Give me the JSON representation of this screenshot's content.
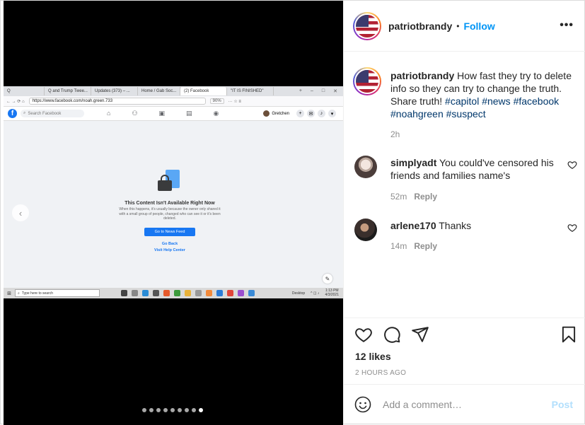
{
  "media": {
    "screenshot": {
      "tabs": [
        {
          "label": "Q",
          "active": false
        },
        {
          "label": "Q and Trump Twee...",
          "active": false
        },
        {
          "label": "Updates (373) – ...",
          "active": false
        },
        {
          "label": "Home / Gab Soc...",
          "active": false
        },
        {
          "label": "(2) Facebook",
          "active": true
        },
        {
          "label": "\"IT IS FINISHED\"",
          "active": false
        }
      ],
      "url": "https://www.facebook.com/noah.green.733",
      "zoom": "90%",
      "fb_search_placeholder": "Search Facebook",
      "fb_user": "Gretchen",
      "notif_count": "1",
      "title": "This Content Isn't Available Right Now",
      "body": "When this happens, it's usually because the owner only shared it with a small group of people, changed who can see it or it's been deleted.",
      "news_feed_button": "Go to News Feed",
      "go_back": "Go Back",
      "help_center": "Visit Help Center",
      "taskbar_search": "Type here to search",
      "desktop_label": "Desktop",
      "clock_time": "1:13 PM",
      "clock_date": "4/3/2021"
    },
    "carousel": {
      "total": 9,
      "active_index": 8
    }
  },
  "post": {
    "username": "patriotbrandy",
    "follow_label": "Follow",
    "caption": {
      "username": "patriotbrandy",
      "text": "How fast they try to delete info so they can try to change the truth. Share truth!",
      "hashtags": [
        "#capitol",
        "#news",
        "#facebook",
        "#noahgreen",
        "#suspect"
      ],
      "time": "2h"
    },
    "comments": [
      {
        "username": "simplyadt",
        "text": "You could've censored his friends and families name's",
        "time": "52m",
        "reply_label": "Reply"
      },
      {
        "username": "arlene170",
        "text": "Thanks",
        "time": "14m",
        "reply_label": "Reply"
      }
    ],
    "likes": "12 likes",
    "posted_ago": "2 HOURS AGO",
    "comment_placeholder": "Add a comment…",
    "post_label": "Post"
  }
}
